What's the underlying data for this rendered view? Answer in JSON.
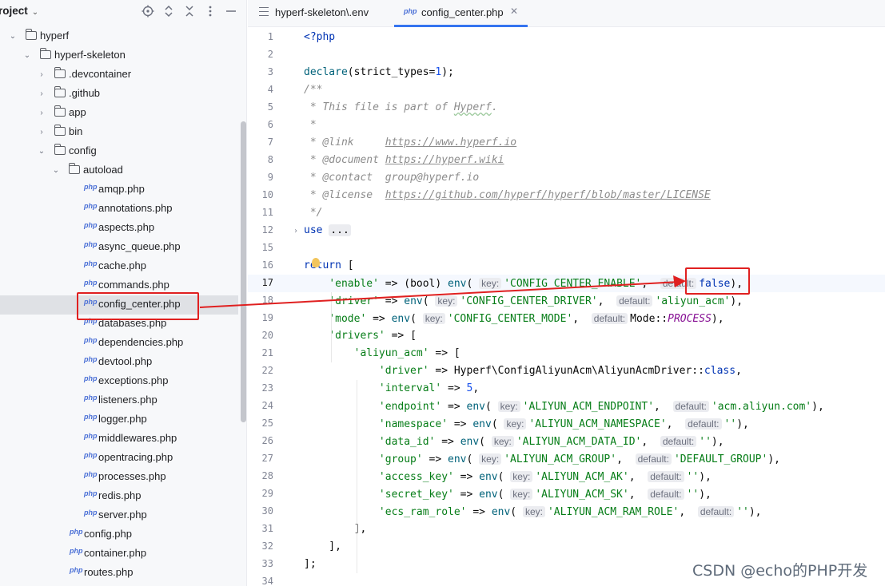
{
  "sidebar": {
    "title": "roject",
    "tree": [
      {
        "label": "hyperf",
        "type": "folder",
        "expanded": true,
        "depth": 0
      },
      {
        "label": "hyperf-skeleton",
        "type": "folder",
        "expanded": true,
        "depth": 1
      },
      {
        "label": ".devcontainer",
        "type": "folder",
        "expanded": false,
        "depth": 2
      },
      {
        "label": ".github",
        "type": "folder",
        "expanded": false,
        "depth": 2
      },
      {
        "label": "app",
        "type": "folder",
        "expanded": false,
        "depth": 2
      },
      {
        "label": "bin",
        "type": "folder",
        "expanded": false,
        "depth": 2
      },
      {
        "label": "config",
        "type": "folder",
        "expanded": true,
        "depth": 2
      },
      {
        "label": "autoload",
        "type": "folder",
        "expanded": true,
        "depth": 3
      },
      {
        "label": "amqp.php",
        "type": "php",
        "depth": 4
      },
      {
        "label": "annotations.php",
        "type": "php",
        "depth": 4
      },
      {
        "label": "aspects.php",
        "type": "php",
        "depth": 4
      },
      {
        "label": "async_queue.php",
        "type": "php",
        "depth": 4
      },
      {
        "label": "cache.php",
        "type": "php",
        "depth": 4
      },
      {
        "label": "commands.php",
        "type": "php",
        "depth": 4
      },
      {
        "label": "config_center.php",
        "type": "php",
        "depth": 4,
        "selected": true
      },
      {
        "label": "databases.php",
        "type": "php",
        "depth": 4
      },
      {
        "label": "dependencies.php",
        "type": "php",
        "depth": 4
      },
      {
        "label": "devtool.php",
        "type": "php",
        "depth": 4
      },
      {
        "label": "exceptions.php",
        "type": "php",
        "depth": 4
      },
      {
        "label": "listeners.php",
        "type": "php",
        "depth": 4
      },
      {
        "label": "logger.php",
        "type": "php",
        "depth": 4
      },
      {
        "label": "middlewares.php",
        "type": "php",
        "depth": 4
      },
      {
        "label": "opentracing.php",
        "type": "php",
        "depth": 4
      },
      {
        "label": "processes.php",
        "type": "php",
        "depth": 4
      },
      {
        "label": "redis.php",
        "type": "php",
        "depth": 4
      },
      {
        "label": "server.php",
        "type": "php",
        "depth": 4
      },
      {
        "label": "config.php",
        "type": "php",
        "depth": 3
      },
      {
        "label": "container.php",
        "type": "php",
        "depth": 3
      },
      {
        "label": "routes.php",
        "type": "php",
        "depth": 3
      }
    ]
  },
  "icons": {
    "php_badge": "php"
  },
  "tabs": [
    {
      "label": "hyperf-skeleton\\.env",
      "icon": "menu-icon",
      "active": false
    },
    {
      "label": "config_center.php",
      "icon": "php-file-icon",
      "active": true,
      "close": "✕"
    }
  ],
  "editor": {
    "current_line": 17,
    "lines": [
      {
        "n": "1",
        "t": [
          [
            "kw",
            "<?php"
          ]
        ]
      },
      {
        "n": "2",
        "t": []
      },
      {
        "n": "3",
        "t": [
          [
            "fn",
            "declare"
          ],
          [
            "",
            "(strict_types="
          ],
          [
            "num",
            "1"
          ],
          [
            "",
            ");"
          ]
        ]
      },
      {
        "n": "4",
        "t": [
          [
            "cmt",
            "/**"
          ]
        ]
      },
      {
        "n": "5",
        "t": [
          [
            "cmt",
            " * This file is part of "
          ],
          [
            "cmt squig",
            "Hyperf"
          ],
          [
            "cmt",
            "."
          ]
        ]
      },
      {
        "n": "6",
        "t": [
          [
            "cmt",
            " *"
          ]
        ]
      },
      {
        "n": "7",
        "t": [
          [
            "cmt",
            " * "
          ],
          [
            "doctag",
            "@link"
          ],
          [
            "cmt",
            "     "
          ],
          [
            "link",
            "https://www.hyperf.io"
          ]
        ]
      },
      {
        "n": "8",
        "t": [
          [
            "cmt",
            " * "
          ],
          [
            "doctag",
            "@document"
          ],
          [
            "cmt",
            " "
          ],
          [
            "link",
            "https://hyperf.wiki"
          ]
        ]
      },
      {
        "n": "9",
        "t": [
          [
            "cmt",
            " * "
          ],
          [
            "doctag",
            "@contact"
          ],
          [
            "cmt",
            "  group@hyperf.io"
          ]
        ]
      },
      {
        "n": "10",
        "t": [
          [
            "cmt",
            " * "
          ],
          [
            "doctag",
            "@license"
          ],
          [
            "cmt",
            "  "
          ],
          [
            "link",
            "https://github.com/hyperf/hyperf/blob/master/LICENSE"
          ]
        ]
      },
      {
        "n": "11",
        "t": [
          [
            "cmt",
            " */"
          ]
        ]
      },
      {
        "n": "12",
        "t": [
          [
            "kw",
            "use"
          ],
          [
            "",
            " "
          ],
          [
            "fold",
            "..."
          ]
        ]
      },
      {
        "n": "15",
        "t": []
      },
      {
        "n": "16",
        "t": [
          [
            "kw",
            "return"
          ],
          [
            "",
            " ["
          ]
        ]
      },
      {
        "n": "17",
        "t": [
          [
            "",
            "    "
          ],
          [
            "str",
            "'enable'"
          ],
          [
            "",
            " => (bool) "
          ],
          [
            "fn",
            "env"
          ],
          [
            "",
            "( "
          ],
          [
            "hint",
            "key:"
          ],
          [
            "str",
            "'CONFIG_CENTER_ENABLE'"
          ],
          [
            "",
            ",  "
          ],
          [
            "hint",
            "default:"
          ],
          [
            "kw",
            "false"
          ],
          [
            "",
            "),"
          ]
        ]
      },
      {
        "n": "18",
        "t": [
          [
            "",
            "    "
          ],
          [
            "str",
            "'driver'"
          ],
          [
            "",
            " => "
          ],
          [
            "fn",
            "env"
          ],
          [
            "",
            "( "
          ],
          [
            "hint",
            "key:"
          ],
          [
            "str",
            "'CONFIG_CENTER_DRIVER'"
          ],
          [
            "",
            ",  "
          ],
          [
            "hint",
            "default:"
          ],
          [
            "str",
            "'aliyun_acm'"
          ],
          [
            "",
            "),"
          ]
        ]
      },
      {
        "n": "19",
        "t": [
          [
            "",
            "    "
          ],
          [
            "str",
            "'mode'"
          ],
          [
            "",
            " => "
          ],
          [
            "fn",
            "env"
          ],
          [
            "",
            "( "
          ],
          [
            "hint",
            "key:"
          ],
          [
            "str",
            "'CONFIG_CENTER_MODE'"
          ],
          [
            "",
            ",  "
          ],
          [
            "hint",
            "default:"
          ],
          [
            "",
            "Mode::"
          ],
          [
            "const",
            "PROCESS"
          ],
          [
            "",
            "),"
          ]
        ]
      },
      {
        "n": "20",
        "t": [
          [
            "",
            "    "
          ],
          [
            "str",
            "'drivers'"
          ],
          [
            "",
            " => ["
          ]
        ]
      },
      {
        "n": "21",
        "t": [
          [
            "",
            "        "
          ],
          [
            "str",
            "'aliyun_acm'"
          ],
          [
            "",
            " => ["
          ]
        ]
      },
      {
        "n": "22",
        "t": [
          [
            "",
            "            "
          ],
          [
            "str",
            "'driver'"
          ],
          [
            "",
            " => Hyperf\\ConfigAliyunAcm\\AliyunAcmDriver::"
          ],
          [
            "kw",
            "class"
          ],
          [
            "",
            ","
          ]
        ]
      },
      {
        "n": "23",
        "t": [
          [
            "",
            "            "
          ],
          [
            "str",
            "'interval'"
          ],
          [
            "",
            " => "
          ],
          [
            "num",
            "5"
          ],
          [
            "",
            ","
          ]
        ]
      },
      {
        "n": "24",
        "t": [
          [
            "",
            "            "
          ],
          [
            "str",
            "'endpoint'"
          ],
          [
            "",
            " => "
          ],
          [
            "fn",
            "env"
          ],
          [
            "",
            "( "
          ],
          [
            "hint",
            "key:"
          ],
          [
            "str",
            "'ALIYUN_ACM_ENDPOINT'"
          ],
          [
            "",
            ",  "
          ],
          [
            "hint",
            "default:"
          ],
          [
            "str",
            "'acm.aliyun.com'"
          ],
          [
            "",
            "),"
          ]
        ]
      },
      {
        "n": "25",
        "t": [
          [
            "",
            "            "
          ],
          [
            "str",
            "'namespace'"
          ],
          [
            "",
            " => "
          ],
          [
            "fn",
            "env"
          ],
          [
            "",
            "( "
          ],
          [
            "hint",
            "key:"
          ],
          [
            "str",
            "'ALIYUN_ACM_NAMESPACE'"
          ],
          [
            "",
            ",  "
          ],
          [
            "hint",
            "default:"
          ],
          [
            "str",
            "''"
          ],
          [
            "",
            "),"
          ]
        ]
      },
      {
        "n": "26",
        "t": [
          [
            "",
            "            "
          ],
          [
            "str",
            "'data_id'"
          ],
          [
            "",
            " => "
          ],
          [
            "fn",
            "env"
          ],
          [
            "",
            "( "
          ],
          [
            "hint",
            "key:"
          ],
          [
            "str",
            "'ALIYUN_ACM_DATA_ID'"
          ],
          [
            "",
            ",  "
          ],
          [
            "hint",
            "default:"
          ],
          [
            "str",
            "''"
          ],
          [
            "",
            "),"
          ]
        ]
      },
      {
        "n": "27",
        "t": [
          [
            "",
            "            "
          ],
          [
            "str",
            "'group'"
          ],
          [
            "",
            " => "
          ],
          [
            "fn",
            "env"
          ],
          [
            "",
            "( "
          ],
          [
            "hint",
            "key:"
          ],
          [
            "str",
            "'ALIYUN_ACM_GROUP'"
          ],
          [
            "",
            ",  "
          ],
          [
            "hint",
            "default:"
          ],
          [
            "str",
            "'DEFAULT_GROUP'"
          ],
          [
            "",
            "),"
          ]
        ]
      },
      {
        "n": "28",
        "t": [
          [
            "",
            "            "
          ],
          [
            "str",
            "'access_key'"
          ],
          [
            "",
            " => "
          ],
          [
            "fn",
            "env"
          ],
          [
            "",
            "( "
          ],
          [
            "hint",
            "key:"
          ],
          [
            "str",
            "'ALIYUN_ACM_AK'"
          ],
          [
            "",
            ",  "
          ],
          [
            "hint",
            "default:"
          ],
          [
            "str",
            "''"
          ],
          [
            "",
            "),"
          ]
        ]
      },
      {
        "n": "29",
        "t": [
          [
            "",
            "            "
          ],
          [
            "str",
            "'secret_key'"
          ],
          [
            "",
            " => "
          ],
          [
            "fn",
            "env"
          ],
          [
            "",
            "( "
          ],
          [
            "hint",
            "key:"
          ],
          [
            "str",
            "'ALIYUN_ACM_SK'"
          ],
          [
            "",
            ",  "
          ],
          [
            "hint",
            "default:"
          ],
          [
            "str",
            "''"
          ],
          [
            "",
            "),"
          ]
        ]
      },
      {
        "n": "30",
        "t": [
          [
            "",
            "            "
          ],
          [
            "str",
            "'ecs_ram_role'"
          ],
          [
            "",
            " => "
          ],
          [
            "fn",
            "env"
          ],
          [
            "",
            "( "
          ],
          [
            "hint",
            "key:"
          ],
          [
            "str",
            "'ALIYUN_ACM_RAM_ROLE'"
          ],
          [
            "",
            ",  "
          ],
          [
            "hint",
            "default:"
          ],
          [
            "str",
            "''"
          ],
          [
            "",
            "),"
          ]
        ]
      },
      {
        "n": "31",
        "t": [
          [
            "",
            "        ],"
          ]
        ]
      },
      {
        "n": "32",
        "t": [
          [
            "",
            "    ],"
          ]
        ]
      },
      {
        "n": "33",
        "t": [
          [
            "",
            "];"
          ]
        ]
      },
      {
        "n": "34",
        "t": []
      }
    ]
  },
  "watermark": "CSDN @echo的PHP开发",
  "colors": {
    "annotation_red": "#e02020",
    "accent_blue": "#3574f0"
  }
}
